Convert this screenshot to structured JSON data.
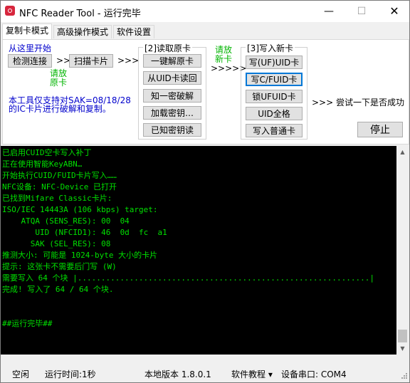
{
  "window": {
    "title": "NFC Reader Tool - 运行完毕",
    "controls": {
      "minimize": "—",
      "maximize": "☐",
      "close": "✕"
    }
  },
  "tabs": [
    "复制卡模式",
    "高级操作模式",
    "软件设置"
  ],
  "left": {
    "start_hint": "从这里开始",
    "detect_button": "检测连接",
    "arrow1": ">>",
    "scan_button": "扫描卡片",
    "arrow2": ">>>",
    "read_source_hint": "请放原卡",
    "note_line1": "本工具仅支持对SAK=08/18/28",
    "note_line2": "的IC卡片进行破解和复制。"
  },
  "read_group": {
    "title": "[2]读取原卡",
    "buttons": [
      "一键解原卡",
      "从UID卡读回",
      "知一密破解",
      "加载密钥…",
      "已知密钥读"
    ]
  },
  "mid": {
    "new_card_hint": "请放新卡",
    "arrow": ">>>>>"
  },
  "write_group": {
    "title": "[3]写入新卡",
    "buttons": [
      "写(UF)UID卡",
      "写C/FUID卡",
      "锁UFUID卡",
      "UID全格",
      "写入普通卡"
    ]
  },
  "right": {
    "try_hint": ">>> 尝试一下是否成功",
    "stop_button": "停止"
  },
  "console": {
    "lines": [
      "已启用CUID空卡写入补丁",
      "正在使用智能KeyABN…",
      "开始执行CUID/FUID卡片写入……",
      "NFC设备: NFC-Device 已打开",
      "已找到Mifare Classic卡片:",
      "ISO/IEC 14443A (106 kbps) target:",
      "    ATQA (SENS_RES): 00  04",
      "       UID (NFCID1): 46  0d  fc  a1",
      "      SAK (SEL_RES): 08",
      "推测大小: 可能是 1024-byte 大小的卡片",
      "提示: 这张卡不需要后门写 (W)",
      "需要写入 64 个块 |..............................................................|",
      "完成! 写入了 64 / 64 个块.",
      "",
      "",
      "##运行完毕##"
    ]
  },
  "statusbar": {
    "state": "空闲",
    "runtime": "运行时间:1秒",
    "version": "本地版本 1.8.0.1",
    "tutorial": "软件教程 ▾",
    "port": "设备串口: COM4"
  },
  "colors": {
    "hint_blue": "#0000cc",
    "hint_green": "#00b400",
    "console_bg": "#000000",
    "console_text": "#00e000"
  }
}
